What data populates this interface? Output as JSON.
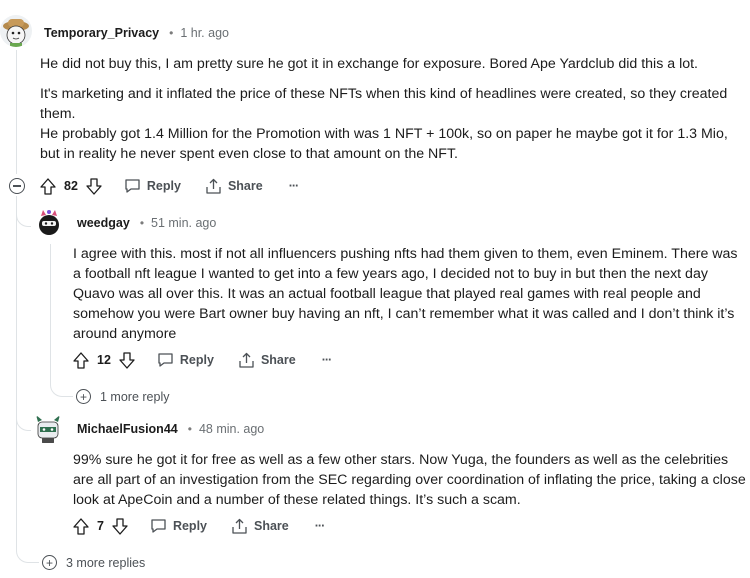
{
  "comments": [
    {
      "author": "Temporary_Privacy",
      "separator": "•",
      "time": "1 hr. ago",
      "paragraphs": [
        "He did not buy this, I am pretty sure he got it in exchange for exposure. Bored Ape Yardclub did this a lot.",
        "It's marketing and it inflated the price of these NFTs when this kind of headlines were created, so they created them.",
        "He probably got 1.4 Million for the Promotion with was 1 NFT + 100k, so on paper he maybe got it for 1.3 Mio, but in reality he never spent even close to that amount on the NFT."
      ],
      "votes": "82",
      "reply_label": "Reply",
      "share_label": "Share",
      "more_label": "···"
    },
    {
      "author": "weedgay",
      "separator": "•",
      "time": "51 min. ago",
      "paragraphs": [
        "I agree with this. most if not all influencers pushing nfts had them given to them, even Eminem. There was a football nft league I wanted to get into a few years ago, I decided not to buy in but then the next day Quavo was all over this. It was an actual football league that played real games with real people and somehow you were Bart owner buy having an nft, I can’t remember what it was called and I don’t think it’s around anymore"
      ],
      "votes": "12",
      "reply_label": "Reply",
      "share_label": "Share",
      "more_label": "···",
      "more_replies": "1 more reply"
    },
    {
      "author": "MichaelFusion44",
      "separator": "•",
      "time": "48 min. ago",
      "paragraphs": [
        "99% sure he got it for free as well as a few other stars. Now Yuga, the founders as well as the celebrities are all part of an investigation from the SEC regarding over coordination of inflating the price, taking a close look at ApeCoin and a number of these related things. It’s such a scam."
      ],
      "votes": "7",
      "reply_label": "Reply",
      "share_label": "Share",
      "more_label": "···"
    }
  ],
  "thread": {
    "more_replies": "3 more replies"
  },
  "icons": {
    "upvote": "upvote-arrow-icon",
    "downvote": "downvote-arrow-icon",
    "reply": "speech-bubble-icon",
    "share": "share-icon",
    "collapse": "collapse-minus-icon",
    "expand": "expand-plus-icon"
  },
  "colors": {
    "text": "#1c1c1c",
    "muted": "#6a6f73",
    "action": "#4c5156",
    "thread_line": "#dfe3e6"
  }
}
